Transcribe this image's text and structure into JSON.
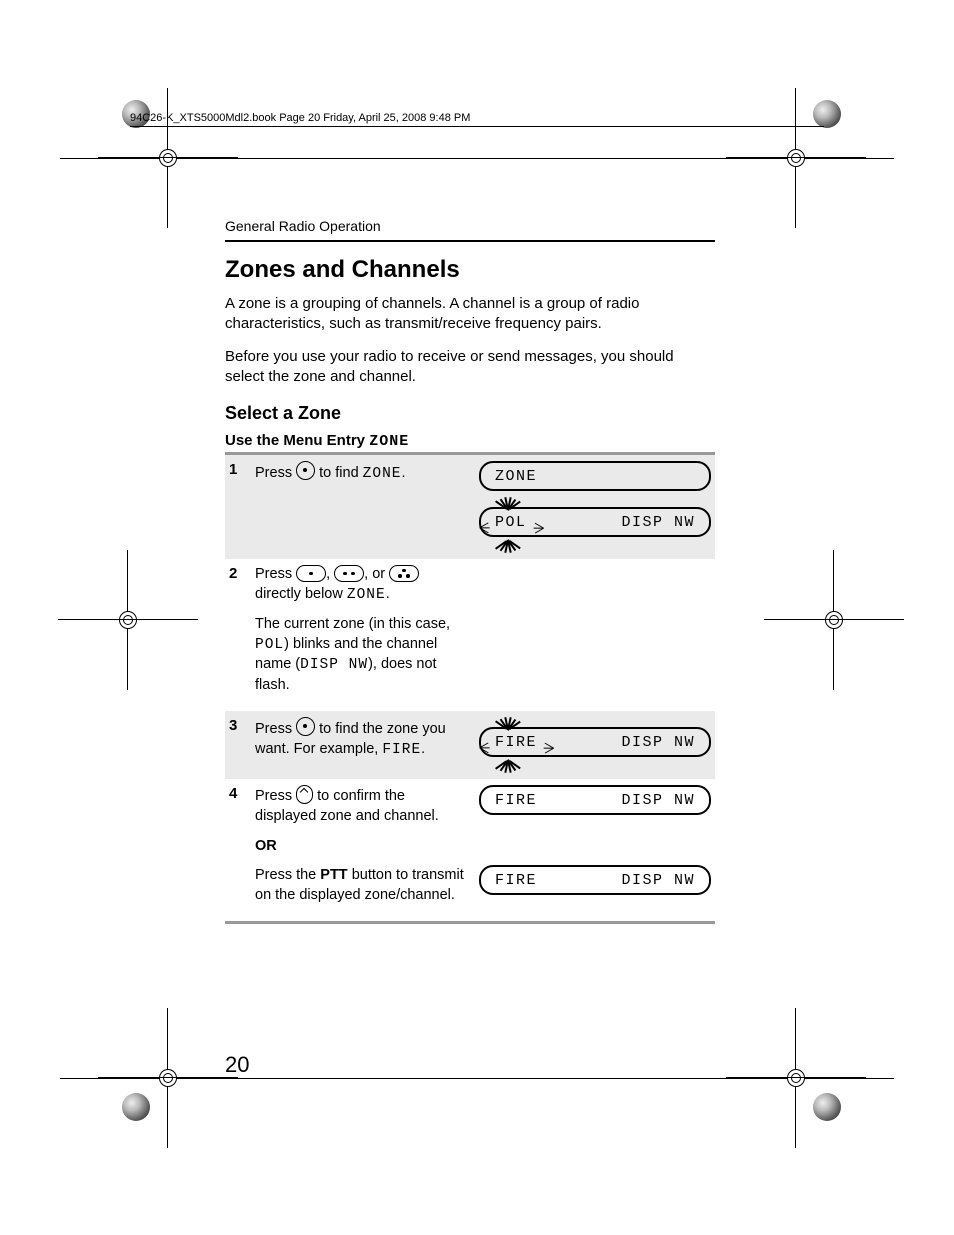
{
  "header_meta": "94C26-K_XTS5000Mdl2.book  Page 20  Friday, April 25, 2008  9:48 PM",
  "section_label": "General Radio Operation",
  "title": "Zones and Channels",
  "intro": [
    "A zone is a grouping of channels. A channel is a group of radio characteristics, such as transmit/receive frequency pairs.",
    "Before you use your radio to receive or send messages, you should select the zone and channel."
  ],
  "subhead": "Select a Zone",
  "menu_heading_prefix": "Use the Menu Entry",
  "menu_heading_code": "ZONE",
  "steps": {
    "s1": {
      "num": "1",
      "a": "Press",
      "b": "to find",
      "c": "ZONE",
      "d": "."
    },
    "s2": {
      "num": "2",
      "a": "Press",
      "b": ",",
      "c": ", or",
      "d": "directly below",
      "e": "ZONE",
      "f": ".",
      "para2a": "The current zone (in this case,",
      "para2b": "POL",
      "para2c": ") blinks and the channel name (",
      "para2d": "DISP NW",
      "para2e": "), does not flash."
    },
    "s3": {
      "num": "3",
      "a": "Press",
      "b": "to find the zone you want. For example,",
      "c": "FIRE",
      "d": "."
    },
    "s4": {
      "num": "4",
      "a": "Press",
      "b": "to confirm the displayed zone and channel.",
      "or": "OR",
      "alt_a": "Press the",
      "alt_b": "PTT",
      "alt_c": "button to transmit on the displayed zone/channel."
    }
  },
  "displays": {
    "d1_top": "ZONE",
    "d1_left": "POL",
    "d1_right": "DISP NW",
    "d3_left": "FIRE",
    "d3_right": "DISP NW",
    "d4a_left": "FIRE",
    "d4a_right": "DISP NW",
    "d4b_left": "FIRE",
    "d4b_right": "DISP NW"
  },
  "page_number": "20"
}
